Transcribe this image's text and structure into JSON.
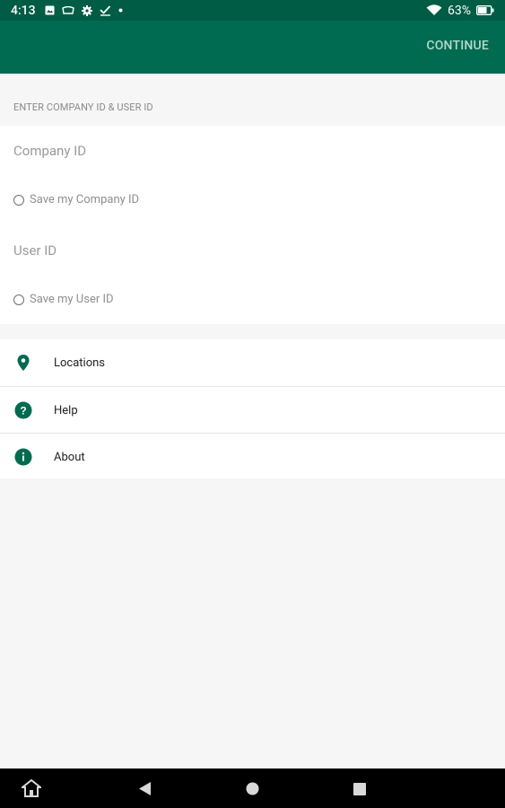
{
  "status_bar": {
    "time": "4:13",
    "battery": "63%",
    "icons": [
      "image-icon",
      "cast-icon",
      "gear-icon",
      "check-icon",
      "dot-icon",
      "wifi-icon",
      "battery-icon"
    ]
  },
  "app_bar": {
    "continue_label": "CONTINUE"
  },
  "form": {
    "section_header": "ENTER COMPANY ID & USER ID",
    "company_id_placeholder": "Company ID",
    "save_company_label": "Save my Company ID",
    "user_id_placeholder": "User ID",
    "save_user_label": "Save my User ID"
  },
  "menu": {
    "items": [
      {
        "label": "Locations",
        "icon": "location-pin-icon"
      },
      {
        "label": "Help",
        "icon": "help-icon"
      },
      {
        "label": "About",
        "icon": "info-icon"
      }
    ]
  },
  "nav_bar": {
    "buttons": [
      "home-icon",
      "back-icon",
      "home-circle-icon",
      "recents-icon"
    ]
  },
  "colors": {
    "status_bar": "#005c44",
    "app_bar": "#006b51",
    "accent": "#006b51",
    "continue_text": "#b7d9cd"
  }
}
